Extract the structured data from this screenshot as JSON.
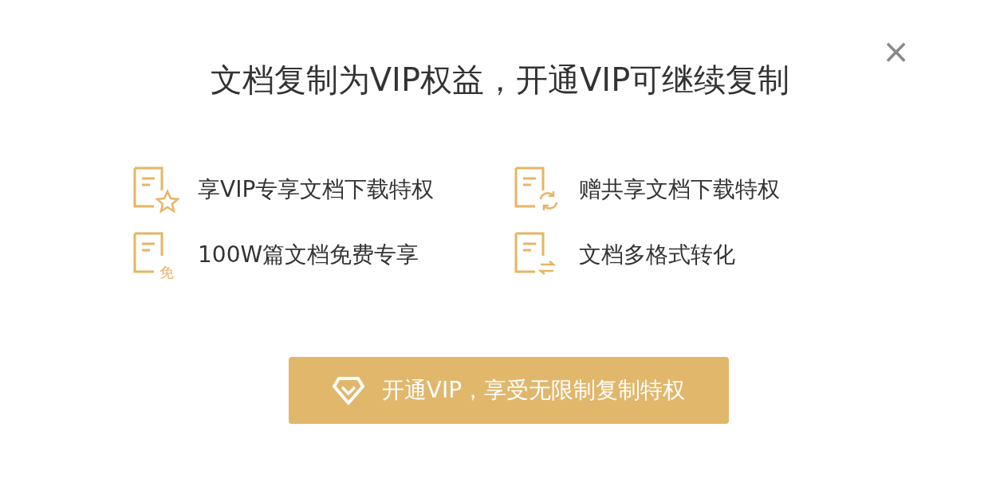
{
  "dialog": {
    "title": "文档复制为VIP权益，开通VIP可继续复制",
    "close": "×"
  },
  "features": [
    {
      "kind": "star",
      "label": "享VIP专享文档下载特权"
    },
    {
      "kind": "sync",
      "label": "赠共享文档下载特权"
    },
    {
      "kind": "free",
      "label": "100W篇文档免费专享",
      "badge": "免"
    },
    {
      "kind": "convert",
      "label": "文档多格式转化"
    }
  ],
  "button": {
    "label": "开通VIP，享受无限制复制特权"
  }
}
